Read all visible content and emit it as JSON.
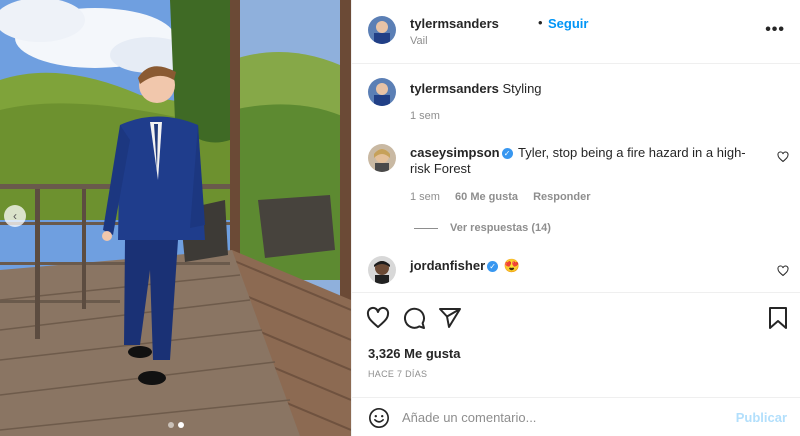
{
  "post": {
    "author": "tylermsanders",
    "separator": "•",
    "follow_label": "Seguir",
    "location": "Vail",
    "more_label": "•••"
  },
  "caption": {
    "username": "tylermsanders",
    "text": "Styling",
    "age": "1 sem"
  },
  "comments": [
    {
      "username": "caseysimpson",
      "verified": true,
      "text": "Tyler, stop being a fire hazard in a high-risk Forest",
      "age": "1 sem",
      "likes": "60 Me gusta",
      "reply_label": "Responder",
      "view_replies": "Ver respuestas (14)"
    },
    {
      "username": "jordanfisher",
      "verified": true,
      "text": "😍"
    }
  ],
  "stats": {
    "likes": "3,326 Me gusta",
    "date": "HACE 7 DÍAS"
  },
  "composer": {
    "placeholder": "Añade un comentario...",
    "publish_label": "Publicar"
  },
  "photo": {
    "nav_arrow": "‹",
    "carousel_dots": 2,
    "active_dot": 1
  },
  "colors": {
    "link_blue": "#0095f6",
    "publish_disabled": "#b2dffc",
    "verified_blue": "#3897f0",
    "meta_gray": "#8e8e8e"
  }
}
